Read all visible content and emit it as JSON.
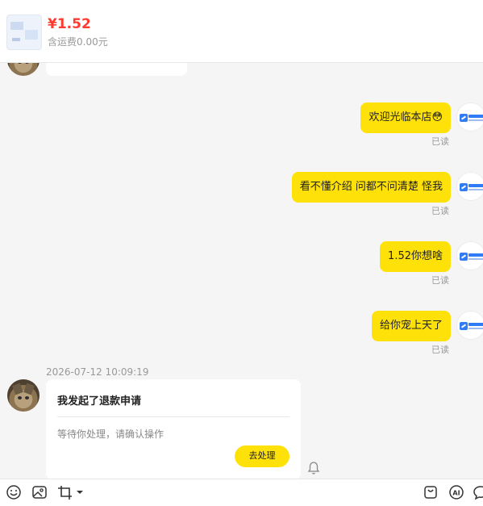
{
  "product": {
    "price": "¥1.52",
    "shipping": "含运费0.00元"
  },
  "messages": [
    {
      "text": "欢迎光临本店😳",
      "status": "已读"
    },
    {
      "text": "看不懂介绍 问都不问清楚 怪我",
      "status": "已读"
    },
    {
      "text": "1.52你想啥",
      "status": "已读"
    },
    {
      "text": "给你宠上天了",
      "status": "已读"
    }
  ],
  "refund_card": {
    "timestamp": "2026-07-12 10:09:19",
    "title": "我发起了退款申请",
    "description": "等待你处理，请确认操作",
    "button_label": "去处理"
  },
  "toolbar": {
    "left_icons": [
      "emoji-icon",
      "image-icon",
      "crop-icon"
    ],
    "right_icons": [
      "order-bag-icon",
      "ai-icon",
      "chat-bubble-icon"
    ]
  },
  "colors": {
    "accent": "#ffe10a",
    "price": "#ff3b30",
    "background": "#f5f5f5"
  }
}
